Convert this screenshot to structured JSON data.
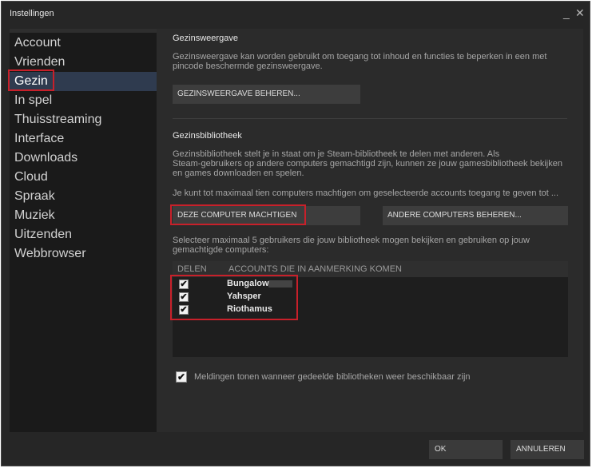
{
  "window": {
    "title": "Instellingen",
    "min": "_",
    "close": "✕"
  },
  "sidebar": {
    "items": [
      {
        "label": "Account"
      },
      {
        "label": "Vrienden"
      },
      {
        "label": "Gezin"
      },
      {
        "label": "In spel"
      },
      {
        "label": "Thuisstreaming"
      },
      {
        "label": "Interface"
      },
      {
        "label": "Downloads"
      },
      {
        "label": "Cloud"
      },
      {
        "label": "Spraak"
      },
      {
        "label": "Muziek"
      },
      {
        "label": "Uitzenden"
      },
      {
        "label": "Webbrowser"
      }
    ],
    "selected": "Gezin"
  },
  "family_view": {
    "heading": "Gezinsweergave",
    "desc_1": "Gezinsweergave kan worden gebruikt om toegang tot inhoud en functies te beperken in een met",
    "desc_2": "pincode beschermde gezinsweergave.",
    "manage_button": "GEZINSWEERGAVE BEHEREN..."
  },
  "library": {
    "heading": "Gezinsbibliotheek",
    "desc_1": "Gezinsbibliotheek stelt je in staat om je Steam-bibliotheek te delen met anderen. Als",
    "desc_2": "Steam-gebruikers op andere computers gemachtigd zijn, kunnen ze jouw gamesbibliotheek bekijken",
    "desc_3": "en games downloaden en spelen.",
    "limit_text": "Je kunt tot maximaal tien computers machtigen om geselecteerde accounts toegang te geven tot ...",
    "authorize_button": "DEZE COMPUTER MACHTIGEN",
    "manage_others_button": "ANDERE COMPUTERS BEHEREN...",
    "select_text_1": "Selecteer maximaal 5 gebruikers die jouw bibliotheek mogen bekijken en gebruiken op jouw",
    "select_text_2": "gemachtigde computers:",
    "col_share": "DELEN",
    "col_accounts": "ACCOUNTS DIE IN AANMERKING KOMEN",
    "accounts": [
      {
        "name": "Bungalow",
        "checked": true
      },
      {
        "name": "Yahsper",
        "checked": true
      },
      {
        "name": "Riothamus",
        "checked": true
      }
    ],
    "notify_label": "Meldingen tonen wanneer gedeelde bibliotheken weer beschikbaar zijn",
    "notify_checked": true
  },
  "footer": {
    "ok": "OK",
    "cancel": "ANNULEREN"
  },
  "colors": {
    "highlight": "#c8202a",
    "selected_nav": "#2f3b4f",
    "window_bg": "#262626"
  },
  "checkmark": "✔"
}
